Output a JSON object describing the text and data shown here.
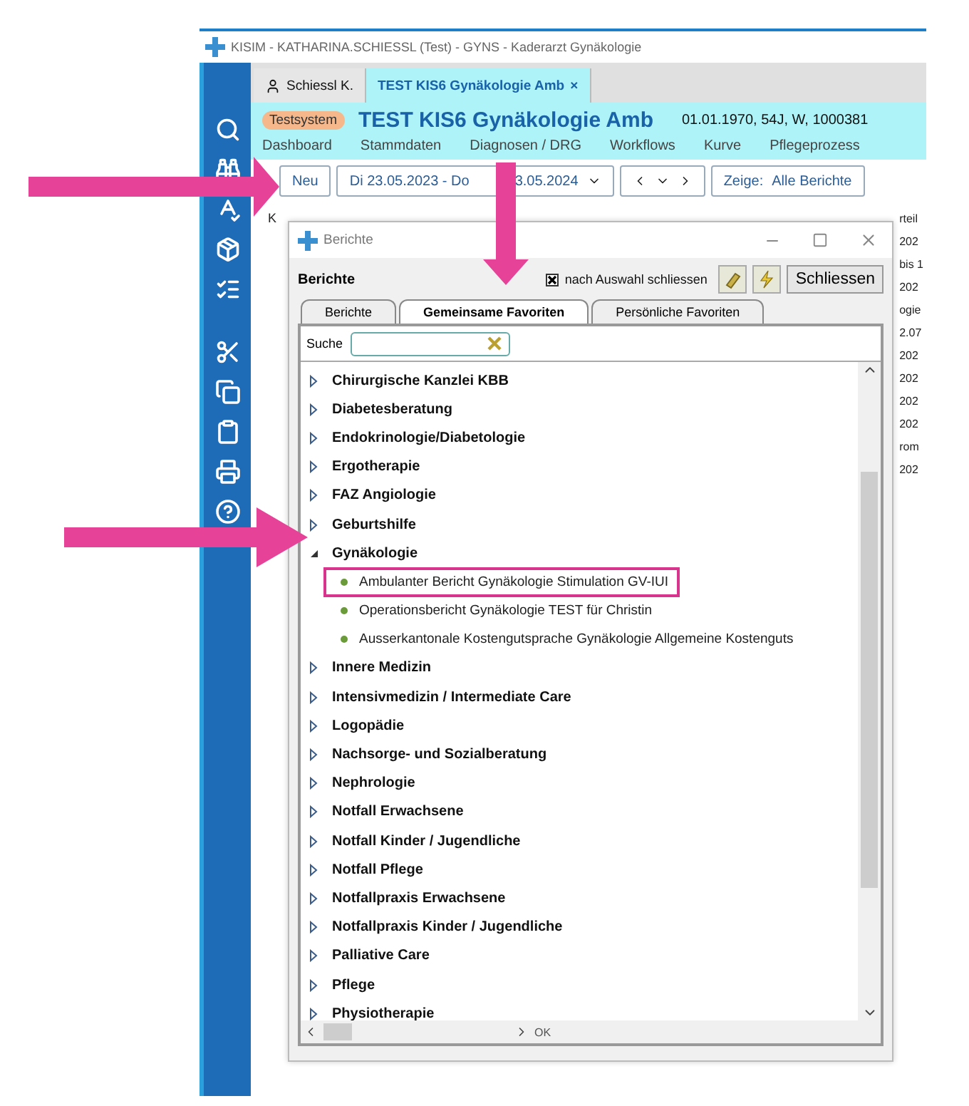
{
  "window": {
    "title": "KISIM - KATHARINA.SCHIESSL (Test) - GYNS - Kaderarzt Gynäkologie"
  },
  "patient_tabs": [
    {
      "label": "Schiessl K.",
      "kind": "user",
      "selected": false
    },
    {
      "label": "TEST KIS6 Gynäkologie Amb",
      "kind": "patient",
      "selected": true,
      "close": "×"
    }
  ],
  "header": {
    "badge": "Testsystem",
    "patient": "TEST KIS6 Gynäkologie Amb",
    "details": "01.01.1970, 54J, W, 1000381"
  },
  "nav": [
    "Dashboard",
    "Stammdaten",
    "Diagnosen / DRG",
    "Workflows",
    "Kurve",
    "Pflegeprozess"
  ],
  "toolbar": {
    "new": "Neu",
    "date_from": "Di  23.05.2023  -  Do",
    "date_to_visible": "3.05.2024",
    "filter_label": "Zeige:",
    "filter_value": "Alle Berichte"
  },
  "background": {
    "column": "K",
    "fragments": [
      "rteil",
      "202",
      "bis 1",
      "202",
      "ogie",
      "2.07",
      "202",
      "202",
      "202",
      "202",
      "rom",
      "202"
    ]
  },
  "dialog": {
    "title": "Berichte",
    "heading": "Berichte",
    "close_after_select": {
      "label": "nach Auswahl schliessen",
      "checked": true
    },
    "close_button": "Schliessen",
    "tabs": [
      {
        "label": "Berichte",
        "selected": false
      },
      {
        "label": "Gemeinsame Favoriten",
        "selected": true
      },
      {
        "label": "Persönliche Favoriten",
        "selected": false
      }
    ],
    "search": {
      "label": "Suche"
    },
    "tree": [
      {
        "label": "Chirurgische Kanzlei KBB",
        "expanded": false
      },
      {
        "label": "Diabetesberatung",
        "expanded": false
      },
      {
        "label": "Endokrinologie/Diabetologie",
        "expanded": false
      },
      {
        "label": "Ergotherapie",
        "expanded": false
      },
      {
        "label": "FAZ Angiologie",
        "expanded": false
      },
      {
        "label": "Geburtshilfe",
        "expanded": false
      },
      {
        "label": "Gynäkologie",
        "expanded": true,
        "children": [
          {
            "label": "Ambulanter Bericht Gynäkologie Stimulation GV-IUI",
            "highlighted": true
          },
          {
            "label": "Operationsbericht Gynäkologie TEST für Christin",
            "highlighted": false
          },
          {
            "label": "Ausserkantonale Kostengutsprache Gynäkologie Allgemeine Kostenguts",
            "highlighted": false
          }
        ]
      },
      {
        "label": "Innere Medizin",
        "expanded": false
      },
      {
        "label": "Intensivmedizin / Intermediate Care",
        "expanded": false
      },
      {
        "label": "Logopädie",
        "expanded": false
      },
      {
        "label": "Nachsorge- und Sozialberatung",
        "expanded": false
      },
      {
        "label": "Nephrologie",
        "expanded": false
      },
      {
        "label": "Notfall Erwachsene",
        "expanded": false
      },
      {
        "label": "Notfall Kinder / Jugendliche",
        "expanded": false
      },
      {
        "label": "Notfall Pflege",
        "expanded": false
      },
      {
        "label": "Notfallpraxis Erwachsene",
        "expanded": false
      },
      {
        "label": "Notfallpraxis Kinder / Jugendliche",
        "expanded": false
      },
      {
        "label": "Palliative Care",
        "expanded": false
      },
      {
        "label": "Pflege",
        "expanded": false
      },
      {
        "label": "Physiotherapie",
        "expanded": false
      }
    ],
    "status": "OK"
  }
}
